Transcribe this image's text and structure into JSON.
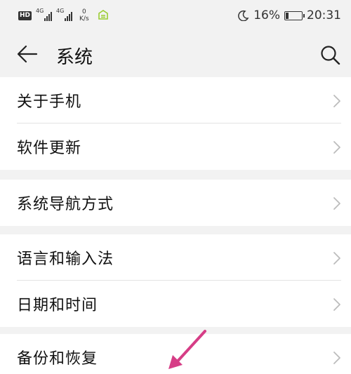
{
  "status_bar": {
    "hd": "HD",
    "net1": "4G",
    "net2": "4G",
    "speed_value": "0",
    "speed_unit": "K/s",
    "battery_percent": "16%",
    "time": "20:31"
  },
  "title_bar": {
    "title": "系统"
  },
  "groups": [
    {
      "items": [
        {
          "label": "关于手机"
        },
        {
          "label": "软件更新"
        }
      ]
    },
    {
      "items": [
        {
          "label": "系统导航方式"
        }
      ]
    },
    {
      "items": [
        {
          "label": "语言和输入法"
        },
        {
          "label": "日期和时间"
        }
      ]
    },
    {
      "items": [
        {
          "label": "备份和恢复"
        }
      ]
    }
  ],
  "colors": {
    "background": "#f2f2f2",
    "card": "#ffffff",
    "annotation_arrow": "#d63d86"
  }
}
